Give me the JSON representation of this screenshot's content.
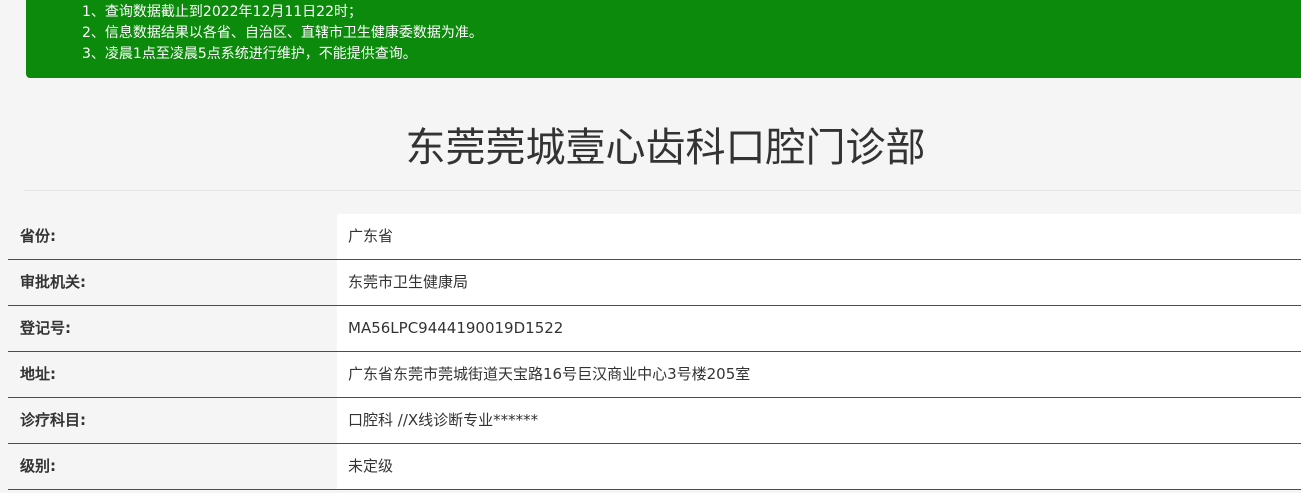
{
  "notice": {
    "lines": [
      "1、查询数据截止到2022年12月11日22时；",
      "2、信息数据结果以各省、自治区、直辖市卫生健康委数据为准。",
      "3、凌晨1点至凌晨5点系统进行维护，不能提供查询。"
    ],
    "background_color": "#0b8a0b"
  },
  "page_title": "东莞莞城壹心齿科口腔门诊部",
  "info_rows": [
    {
      "label": "省份:",
      "value": "广东省"
    },
    {
      "label": "审批机关:",
      "value": "东莞市卫生健康局"
    },
    {
      "label": "登记号:",
      "value": "MA56LPC9444190019D1522"
    },
    {
      "label": "地址:",
      "value": "广东省东莞市莞城街道天宝路16号巨汉商业中心3号楼205室"
    },
    {
      "label": "诊疗科目:",
      "value": "口腔科 //X线诊断专业******"
    },
    {
      "label": "级别:",
      "value": "未定级"
    }
  ],
  "colors": {
    "row_divider": "#1d6b3a",
    "page_background": "#f5f5f5"
  }
}
